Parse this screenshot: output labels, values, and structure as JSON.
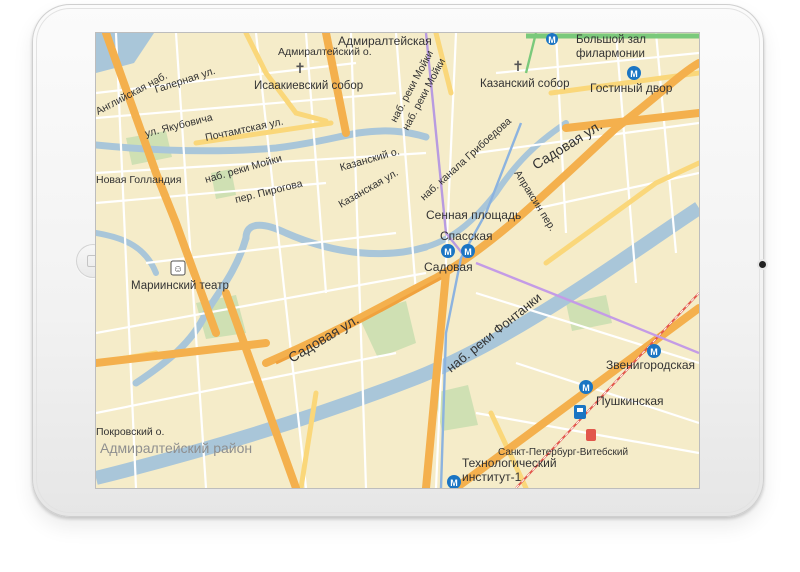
{
  "map": {
    "district": "Адмиралтейский район",
    "streets": {
      "sadovaya_1": "Садовая ул.",
      "sadovaya_2": "Садовая ул.",
      "fontanka": "наб. реки Фонтанки",
      "moika_emb": "наб. реки Мойки",
      "moika_emb2": "наб. реки Мойки",
      "moika_emb3": "наб. реки Мойки",
      "griboedov": "наб. канала Грибоедова",
      "galernaya": "Галерная ул.",
      "yakubovicha": "ул. Якубовича",
      "pochtamtskaya": "Почтамтская ул.",
      "pirogova": "пер. Пирогова",
      "kazansky_per": "Казанский о.",
      "kazanskaya": "Казанская ул.",
      "admiralteyskaya_top": "Адмиралтейская",
      "admiralteysky_o": "Адмиралтейский о.",
      "english_emb": "Английская наб.",
      "novaya_gollandia": "Новая Голландия",
      "apraksin": "Апраксин пер.",
      "pokrovsky": "Покровский о.",
      "spb_vitebsk": "Санкт-Петербург-Витебский"
    },
    "pois": {
      "isaac": "Исаакиевский собор",
      "kazan": "Казанский собор",
      "mariinsky": "Мариинский театр",
      "philharmonic_1": "Большой зал",
      "philharmonic_2": "филармонии"
    },
    "stations": {
      "admiralteyskaya": "Адмиралтейская",
      "gostiny": "Гостиный двор",
      "sennaya": "Сенная площадь",
      "spasskaya": "Спасская",
      "sadovaya": "Садовая",
      "zvenigorodskaya": "Звенигородская",
      "pushkinskaya": "Пушкинская",
      "tekhnolog_1": "Технологический",
      "tekhnolog_2": "институт-1"
    },
    "colors": {
      "land": "#f5ecc9",
      "water": "#a9c6d9",
      "park": "#cfe0b3",
      "major_road": "#f4b04d",
      "secondary_road": "#fad77a",
      "metro": "#1b75c3",
      "railway": "#e2574c"
    }
  }
}
